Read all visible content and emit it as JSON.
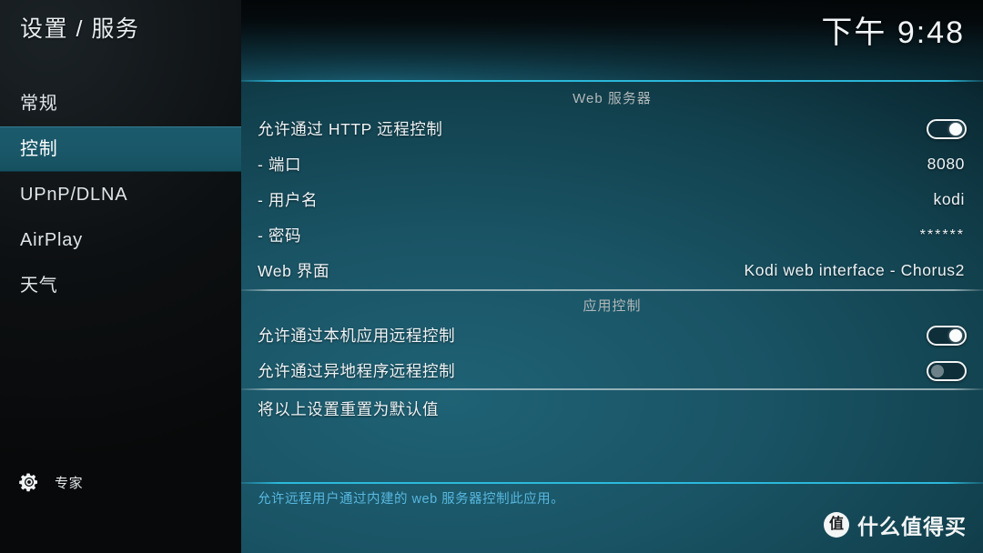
{
  "sidebar": {
    "title": "设置 / 服务",
    "items": [
      {
        "label": "常规",
        "selected": false
      },
      {
        "label": "控制",
        "selected": true
      },
      {
        "label": "UPnP/DLNA",
        "selected": false
      },
      {
        "label": "AirPlay",
        "selected": false
      },
      {
        "label": "天气",
        "selected": false
      }
    ],
    "expert": {
      "icon": "gear-icon",
      "label": "专家"
    }
  },
  "header": {
    "clock": "下午 9:48"
  },
  "sections": [
    {
      "heading": "Web 服务器",
      "rows": [
        {
          "label": "允许通过 HTTP 远程控制",
          "type": "toggle",
          "value": "on"
        },
        {
          "label": "- 端口",
          "type": "value",
          "value": "8080"
        },
        {
          "label": "- 用户名",
          "type": "value",
          "value": "kodi"
        },
        {
          "label": "- 密码",
          "type": "password",
          "value": "******"
        },
        {
          "label": "Web 界面",
          "type": "value",
          "value": "Kodi web interface - Chorus2"
        }
      ]
    },
    {
      "heading": "应用控制",
      "rows": [
        {
          "label": "允许通过本机应用远程控制",
          "type": "toggle",
          "value": "on"
        },
        {
          "label": "允许通过异地程序远程控制",
          "type": "toggle",
          "value": "off"
        }
      ]
    },
    {
      "heading": "",
      "rows": [
        {
          "label": "将以上设置重置为默认值",
          "type": "action",
          "value": ""
        }
      ]
    }
  ],
  "help": {
    "text": "允许远程用户通过内建的 web 服务器控制此应用。"
  },
  "watermark": {
    "badge": "值",
    "text": "什么值得买"
  },
  "colors": {
    "accent_cyan": "#2dbee1",
    "selection_teal": "#1a5a6c",
    "help_blue": "#58b7df",
    "panel_teal": "#1f6275",
    "sidebar_black": "#0d1012"
  }
}
